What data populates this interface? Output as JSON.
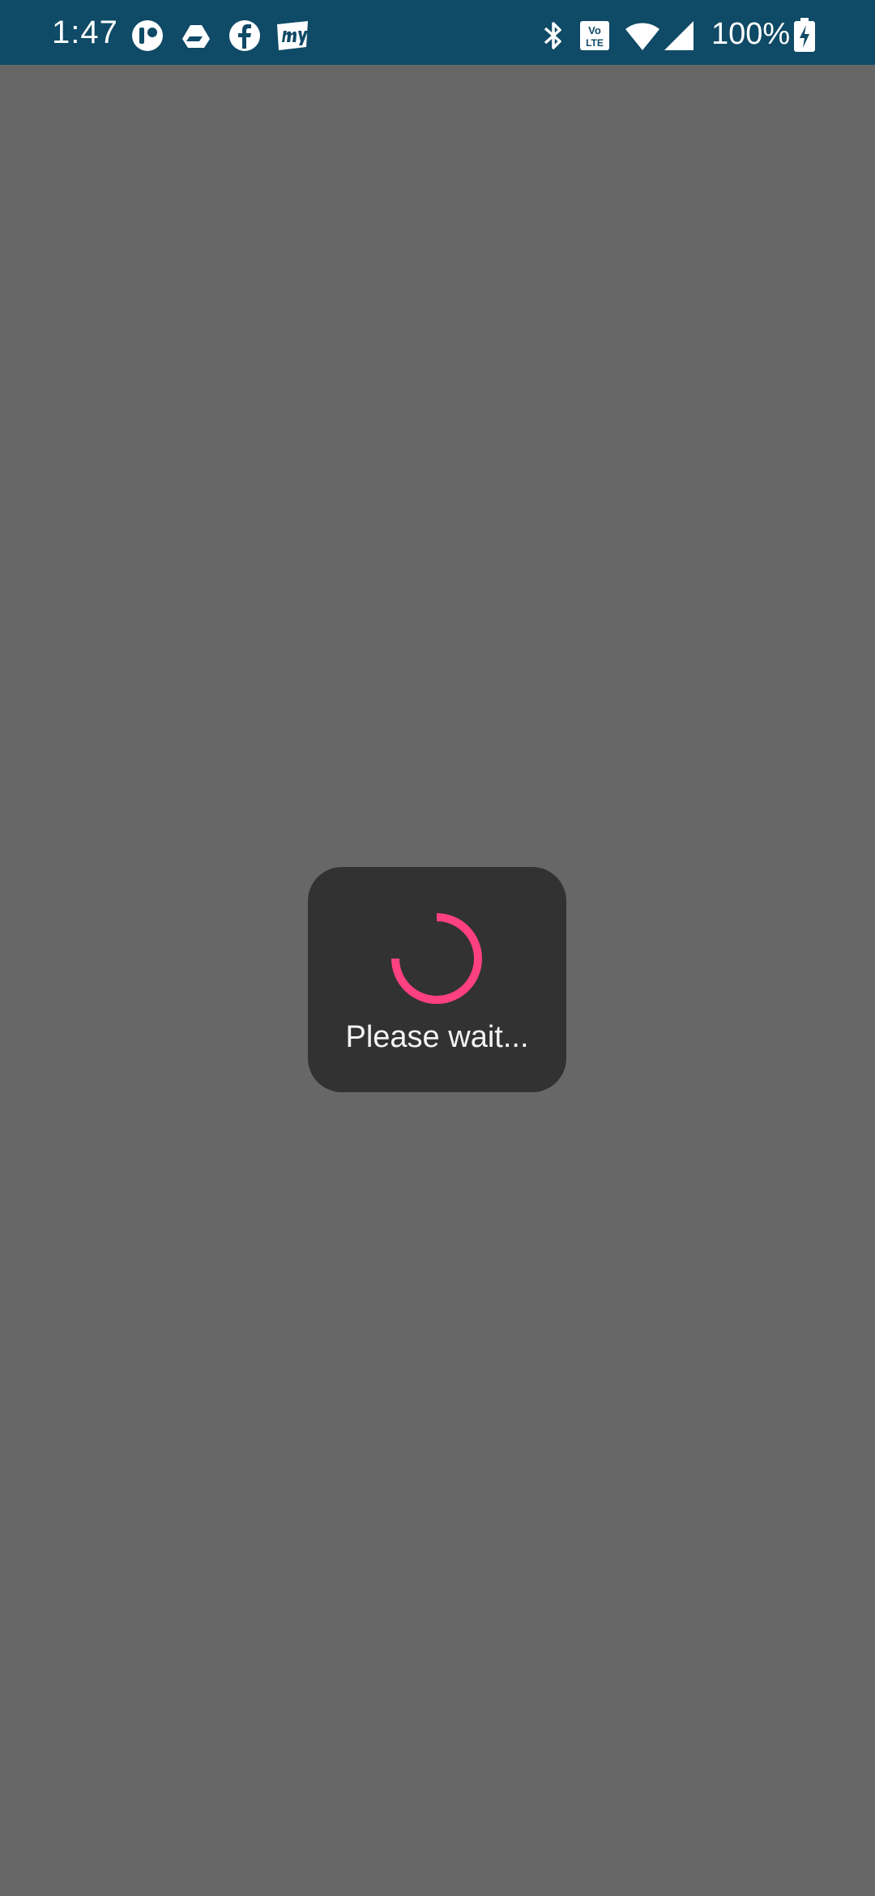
{
  "status_bar": {
    "time": "1:47",
    "battery_percent": "100%",
    "background_color": "#0f4a66",
    "notification_icons": [
      "app-icon",
      "drive-icon",
      "facebook-icon",
      "myntra-icon"
    ],
    "system_icons": [
      "bluetooth-icon",
      "volte-icon",
      "wifi-icon",
      "cell-signal-icon",
      "battery-charging-icon"
    ]
  },
  "dialog": {
    "message": "Please wait...",
    "spinner_color": "#ff4081",
    "background_color": "#323232"
  },
  "screen": {
    "scrim_color": "#676767"
  }
}
